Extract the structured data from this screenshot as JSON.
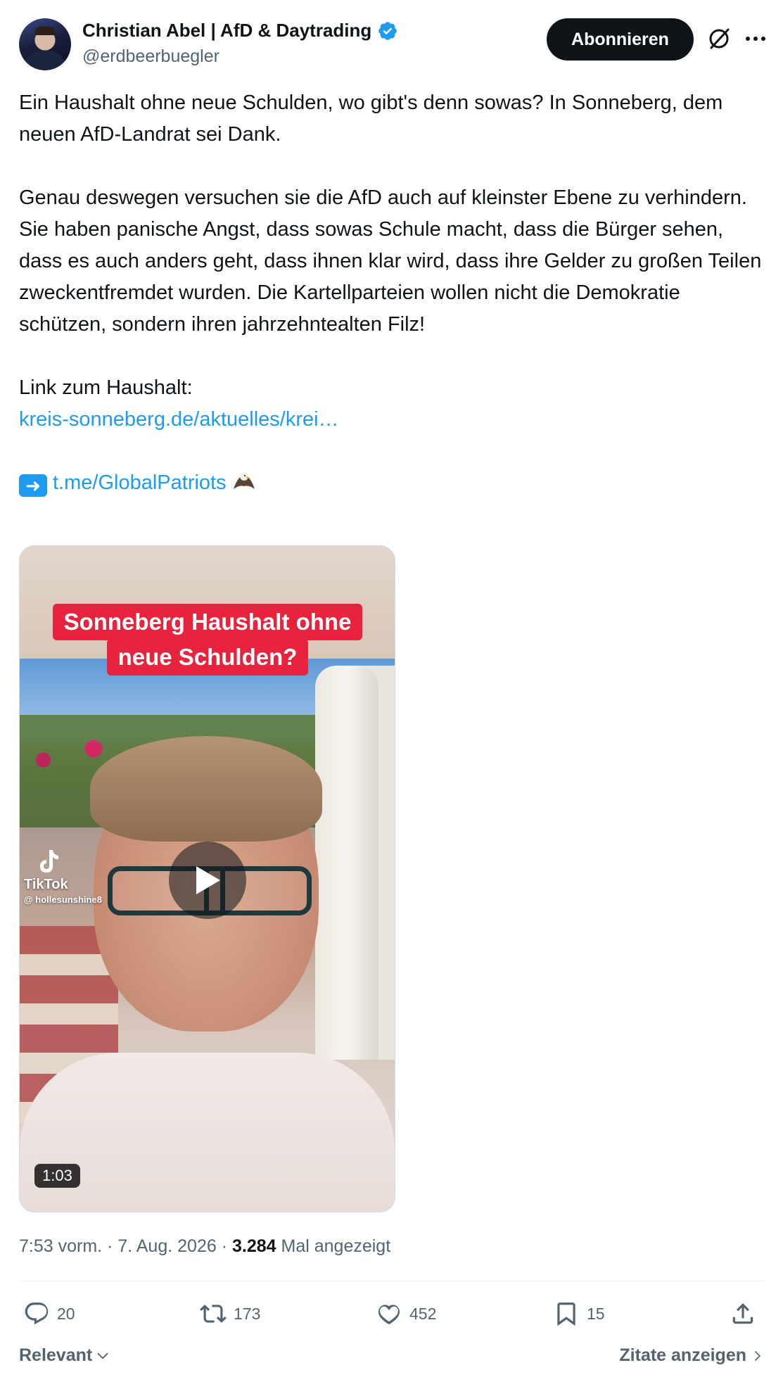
{
  "author": {
    "display_name": "Christian Abel | AfD & Daytrading",
    "handle": "@erdbeerbuegler",
    "verified": true,
    "verified_color": "#1d9bf0"
  },
  "header": {
    "subscribe_label": "Abonnieren",
    "grok_icon": "grok-icon",
    "more_icon": "more-icon"
  },
  "tweet": {
    "paragraph1": "Ein Haushalt ohne neue Schulden, wo gibt's denn sowas? In Sonneberg, dem neuen AfD-Landrat sei Dank.",
    "paragraph2": "Genau deswegen versuchen sie die AfD auch auf kleinster Ebene zu verhindern. Sie haben panische Angst, dass sowas Schule macht, dass die Bürger sehen, dass es auch anders geht, dass ihnen klar wird, dass ihre Gelder zu großen Teilen zweckentfremdet wurden. Die Kartellparteien wollen nicht die Demokratie schützen, sondern ihren jahrzehntealten Filz!",
    "link_intro": "Link zum Haushalt:",
    "link1": "kreis-sonneberg.de/aktuelles/krei…",
    "link2": "t.me/GlobalPatriots",
    "emoji_arrow": "arrow-right-emoji",
    "emoji_eagle": "eagle-emoji"
  },
  "video": {
    "caption_line1": "Sonneberg Haushalt ohne",
    "caption_line2": "neue Schulden?",
    "watermark_brand": "TikTok",
    "watermark_user": "@ hollesunshine8",
    "duration": "1:03"
  },
  "meta": {
    "time": "7:53 vorm.",
    "separator": "·",
    "date": "7. Aug. 2026",
    "views_count": "3.284",
    "views_label": "Mal angezeigt"
  },
  "actions": {
    "replies": "20",
    "retweets": "173",
    "likes": "452",
    "bookmarks": "15"
  },
  "footer": {
    "sort_label": "Relevant",
    "quotes_label": "Zitate anzeigen"
  },
  "colors": {
    "accent": "#1d9bf0",
    "text": "#0f1419",
    "secondary": "#536471",
    "caption_red": "#e8233d"
  }
}
